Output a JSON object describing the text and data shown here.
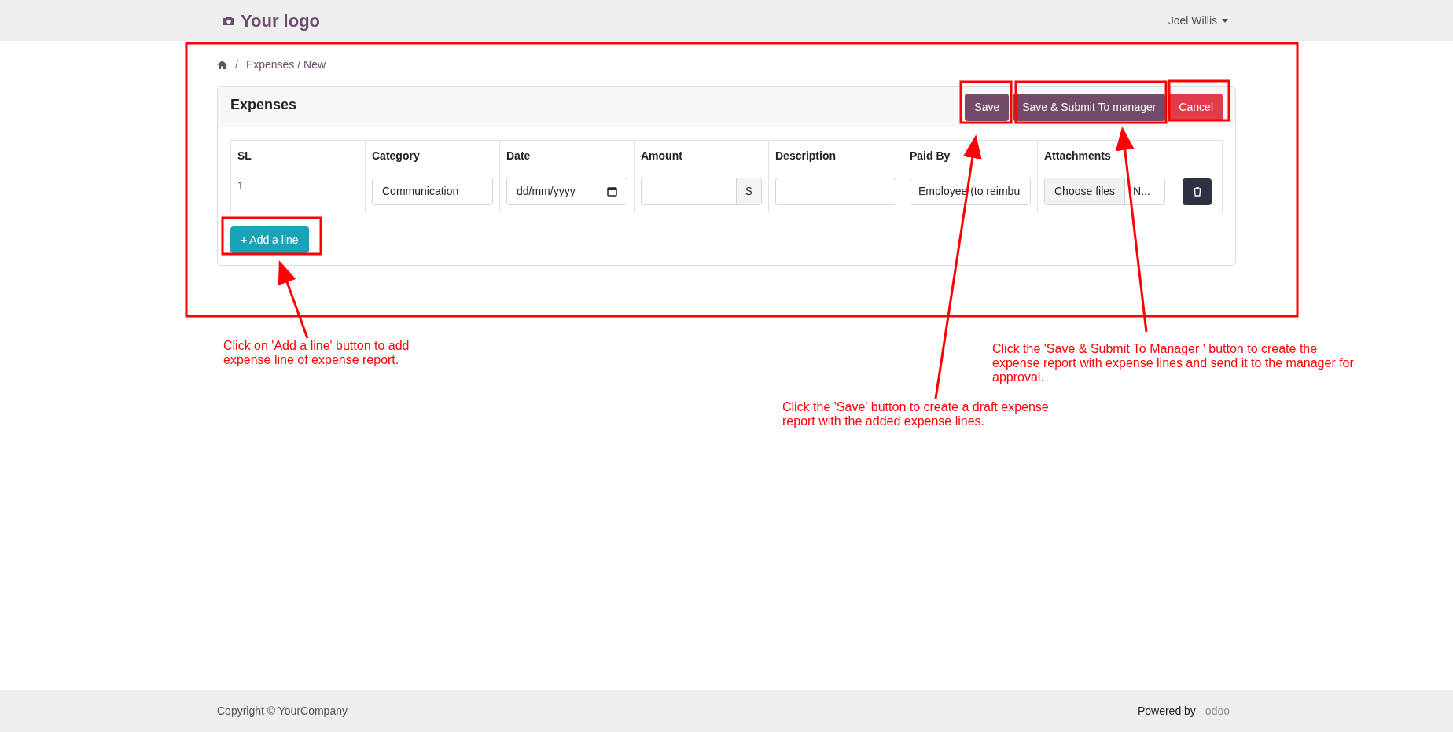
{
  "header": {
    "logo": "Your logo",
    "user": "Joel Willis"
  },
  "breadcrumb": {
    "separator": "/",
    "items": [
      "Expenses / New"
    ]
  },
  "card": {
    "title": "Expenses",
    "buttons": [
      {
        "label": "Save",
        "kind": "primary"
      },
      {
        "label": "Save & Submit To manager",
        "kind": "primary"
      },
      {
        "label": "Cancel",
        "kind": "danger"
      }
    ]
  },
  "table": {
    "columns": [
      "SL",
      "Category",
      "Date",
      "Amount",
      "Description",
      "Paid By",
      "Attachments"
    ],
    "rows": [
      {
        "sl": "1",
        "category": "Communication",
        "date_placeholder": "dd/mm/yyyy",
        "amount": "",
        "currency": "$",
        "description": "",
        "paid_by": "Employee (to reimbu",
        "attachment_button": "Choose files",
        "attachment_name": "N..."
      }
    ]
  },
  "add_line": "+ Add a line",
  "annotations": [
    {
      "text": "Click on 'Add a line' button to add expense line of expense report."
    },
    {
      "text": "Click the 'Save' button to create a draft expense report with the added expense lines."
    },
    {
      "text": "Click the 'Save & Submit To Manager ' button to create the expense report with expense lines and send it to the manager for approval."
    }
  ],
  "footer": {
    "copyright": "Copyright © YourCompany",
    "powered_by": "Powered by",
    "brand": "odoo"
  }
}
